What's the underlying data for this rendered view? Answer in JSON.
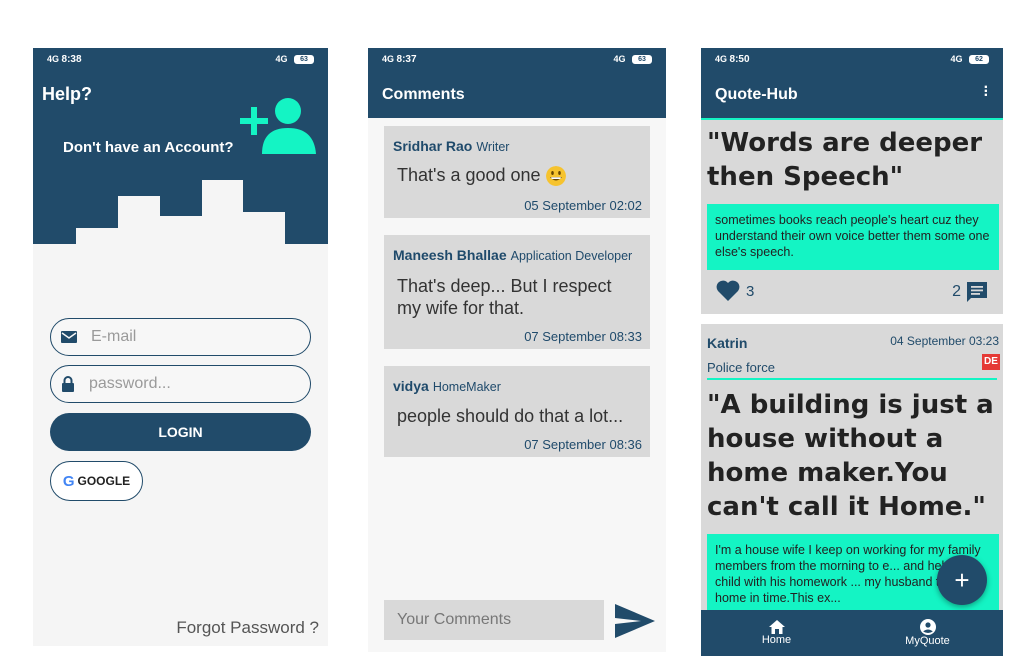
{
  "login_screen": {
    "status": {
      "time": "8:38",
      "signal": "4G",
      "battery": "63"
    },
    "help_label": "Help?",
    "no_account_label": "Don't have an Account?",
    "email_placeholder": "E-mail",
    "password_placeholder": "password...",
    "login_label": "LOGIN",
    "google_label": "GOOGLE",
    "google_g": "G",
    "forgot_label": "Forgot Password ?"
  },
  "comments_screen": {
    "status": {
      "time": "8:37",
      "signal": "4G",
      "battery": "63"
    },
    "title": "Comments",
    "comments": [
      {
        "author": "Sridhar Rao",
        "role": "Writer",
        "text": "That's a good one",
        "date": "05 September 02:02"
      },
      {
        "author": "Maneesh Bhallae",
        "role": "Application Developer",
        "text": "That's deep... But I respect my wife for that.",
        "date": "07 September 08:33"
      },
      {
        "author": "vidya",
        "role": "HomeMaker",
        "text": "people should do that a lot...",
        "date": "07 September 08:36"
      }
    ],
    "compose_placeholder": "Your Comments"
  },
  "feed_screen": {
    "status": {
      "time": "8:50",
      "signal": "4G",
      "battery": "62"
    },
    "title": "Quote-Hub",
    "posts": [
      {
        "quote": "\"Words are deeper then Speech\"",
        "description": "sometimes books reach people's heart cuz they understand their own voice better them some one else's speech.",
        "likes": "3",
        "comments": "2"
      },
      {
        "author": "Katrin",
        "date": "04 September 03:23",
        "role": "Police force",
        "lang_badge": "DE",
        "quote": "\"A building is just a house without a home maker.You can't call it Home.\"",
        "description": "I'm a house wife I keep on working for my family members from the morning to e... and help my child with his homework ... my husband to return home in time.This ex..."
      }
    ],
    "nav": [
      {
        "label": "Home"
      },
      {
        "label": "MyQuote"
      }
    ],
    "fab_label": "+"
  },
  "colors": {
    "primary": "#214b6a",
    "accent": "#14f4c4",
    "card": "#d9d9d9"
  }
}
